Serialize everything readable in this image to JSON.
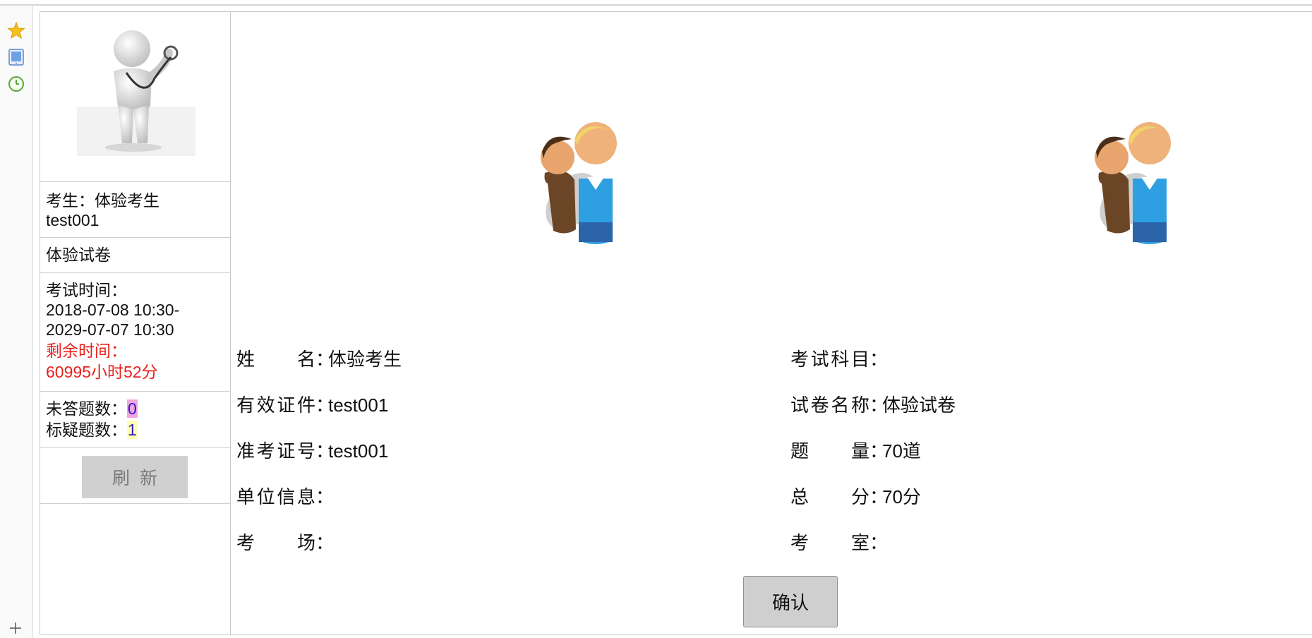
{
  "sidebar": {
    "icons": [
      "star-icon",
      "tablet-icon",
      "clock-icon",
      "plus-icon"
    ]
  },
  "candidate": {
    "label": "考生：",
    "name": "体验考生",
    "id": "test001"
  },
  "paper_name": "体验试卷",
  "exam_time": {
    "label": "考试时间：",
    "range_start": "2018-07-08 10:30-",
    "range_end": "2029-07-07 10:30",
    "remaining_label": "剩余时间：",
    "remaining_value": "60995小时52分"
  },
  "counts": {
    "unanswered_label": "未答题数：",
    "unanswered_value": "0",
    "flagged_label": "标疑题数：",
    "flagged_value": "1"
  },
  "refresh_label": "刷新",
  "info": {
    "left": [
      {
        "label": "姓名",
        "value": "体验考生"
      },
      {
        "label": "有效证件",
        "value": "test001"
      },
      {
        "label": "准考证号",
        "value": "test001"
      },
      {
        "label": "单位信息",
        "value": ""
      },
      {
        "label": "考场",
        "value": ""
      }
    ],
    "right": [
      {
        "label": "考试科目",
        "value": ""
      },
      {
        "label": "试卷名称",
        "value": "体验试卷"
      },
      {
        "label": "题量",
        "value": "70道"
      },
      {
        "label": "总分",
        "value": "70分"
      },
      {
        "label": "考室",
        "value": ""
      }
    ],
    "colon": "："
  },
  "confirm_label": "确认"
}
